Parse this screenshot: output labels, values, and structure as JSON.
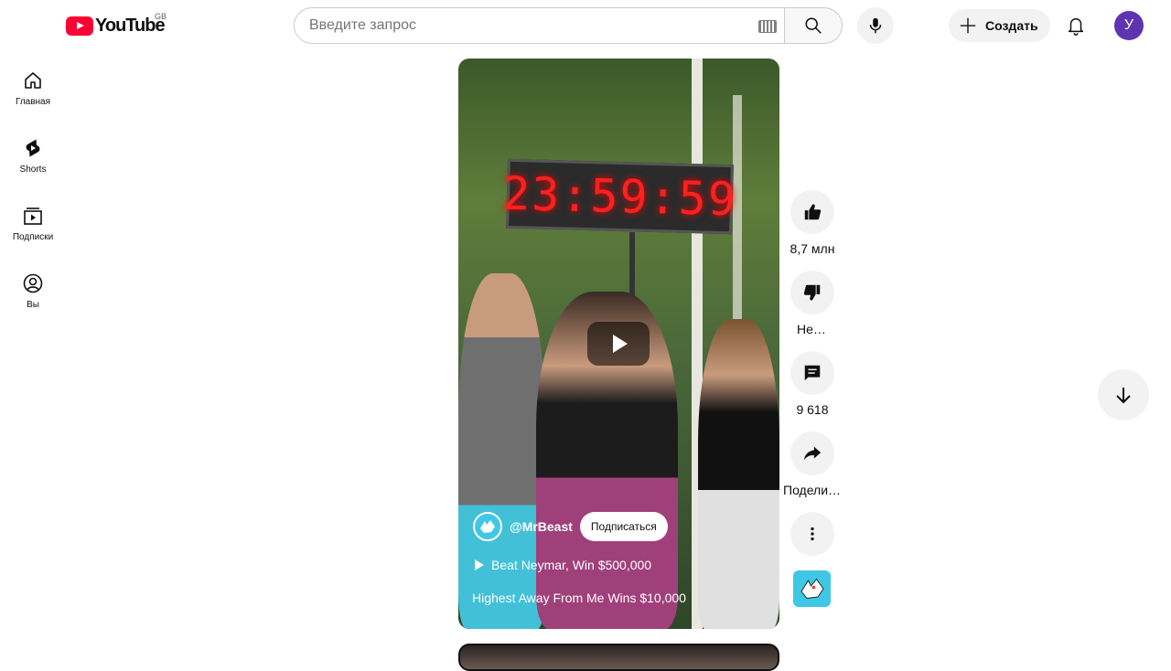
{
  "header": {
    "logo_text": "YouTube",
    "logo_region": "GB",
    "search_placeholder": "Введите запрос",
    "create_label": "Создать",
    "avatar_letter": "У"
  },
  "sidebar": {
    "items": [
      {
        "label": "Главная",
        "icon": "home-icon"
      },
      {
        "label": "Shorts",
        "icon": "shorts-icon"
      },
      {
        "label": "Подписки",
        "icon": "subscriptions-icon"
      },
      {
        "label": "Вы",
        "icon": "you-icon"
      }
    ]
  },
  "video": {
    "timer_text": "23:59:59",
    "channel_name": "@MrBeast",
    "subscribe_label": "Подписаться",
    "playlist_text": "Beat Neymar, Win $500,000",
    "title": "Highest Away From Me Wins $10,000"
  },
  "actions": {
    "likes": "8,7 млн",
    "dislike_label": "Не нравится",
    "comments": "9 618",
    "share_label": "Поделиться"
  },
  "colors": {
    "brand_red": "#ff0033",
    "avatar_bg": "#5e35b1",
    "channel_accent": "#3fc7e6"
  }
}
